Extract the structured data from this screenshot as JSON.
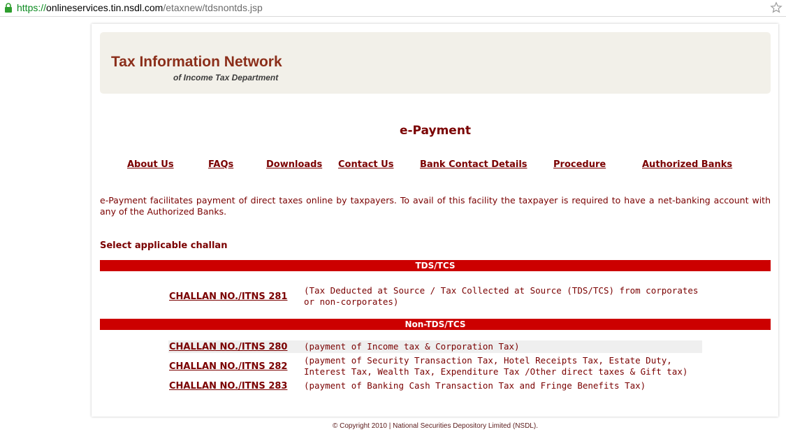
{
  "browser": {
    "url_scheme": "https://",
    "url_host": "onlineservices.tin.nsdl.com",
    "url_path": "/etaxnew/tdsnontds.jsp"
  },
  "banner": {
    "title": "Tax Information Network",
    "subtitle": "of Income Tax Department"
  },
  "page_title": "e-Payment",
  "nav": [
    "About Us",
    "FAQs",
    "Downloads",
    "Contact Us",
    "Bank Contact Details",
    "Procedure",
    "Authorized Banks"
  ],
  "intro": "e-Payment facilitates payment of direct taxes online by taxpayers. To avail of this facility the taxpayer is required to have a net-banking account with any of the Authorized Banks.",
  "select_label": "Select applicable challan",
  "sections": [
    {
      "heading": "TDS/TCS",
      "challans": [
        {
          "link": "CHALLAN NO./ITNS 281",
          "desc": "(Tax Deducted at Source / Tax Collected at Source (TDS/TCS) from corporates or non-corporates)"
        }
      ]
    },
    {
      "heading": "Non-TDS/TCS",
      "challans": [
        {
          "link": "CHALLAN NO./ITNS 280",
          "desc": "(payment of Income tax & Corporation Tax)"
        },
        {
          "link": "CHALLAN NO./ITNS 282",
          "desc": "(payment of Security Transaction Tax, Hotel Receipts Tax, Estate Duty, Interest Tax, Wealth Tax, Expenditure Tax /Other direct taxes & Gift tax)"
        },
        {
          "link": "CHALLAN NO./ITNS 283",
          "desc": "(payment of Banking Cash Transaction Tax and Fringe Benefits Tax)"
        }
      ]
    }
  ],
  "copyright": "© Copyright 2010  |  National Securities Depository Limited (NSDL).",
  "colors": {
    "brand_maroon": "#7a0000",
    "section_red": "#cc0000",
    "banner_bg": "#f2f0e9"
  }
}
